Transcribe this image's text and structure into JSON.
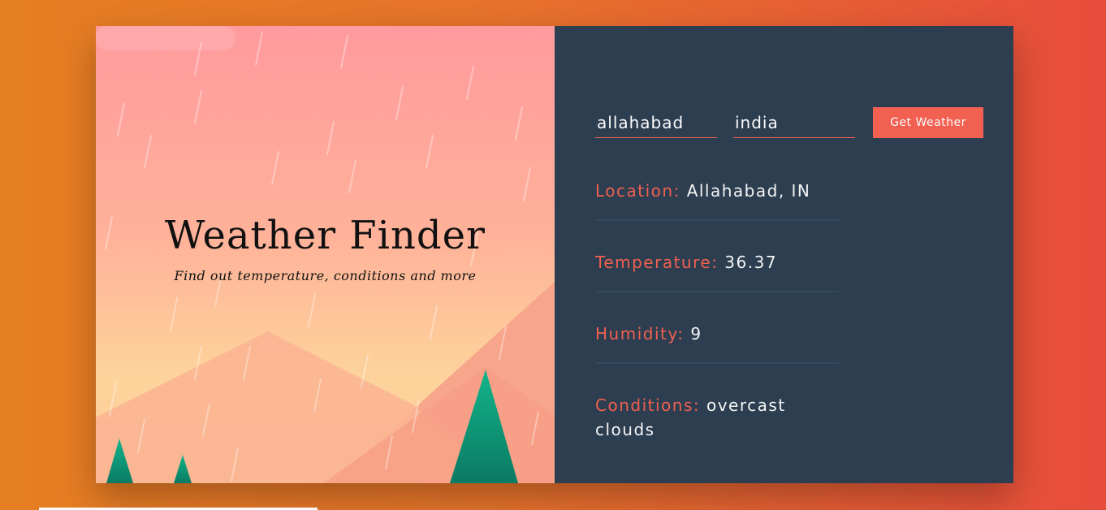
{
  "header": {
    "title": "Weather Finder",
    "subtitle": "Find out temperature, conditions and more"
  },
  "form": {
    "city_value": "allahabad",
    "country_value": "india",
    "submit_label": "Get Weather"
  },
  "weather": {
    "location": {
      "label": "Location:",
      "value": "Allahabad, IN"
    },
    "temperature": {
      "label": "Temperature:",
      "value": "36.37"
    },
    "humidity": {
      "label": "Humidity:",
      "value": "9"
    },
    "conditions": {
      "label": "Conditions:",
      "value": "overcast clouds"
    }
  },
  "colors": {
    "accent": "#f16051",
    "panel": "#2c3e50",
    "background_start": "#e67e22",
    "background_end": "#e74c3c"
  }
}
